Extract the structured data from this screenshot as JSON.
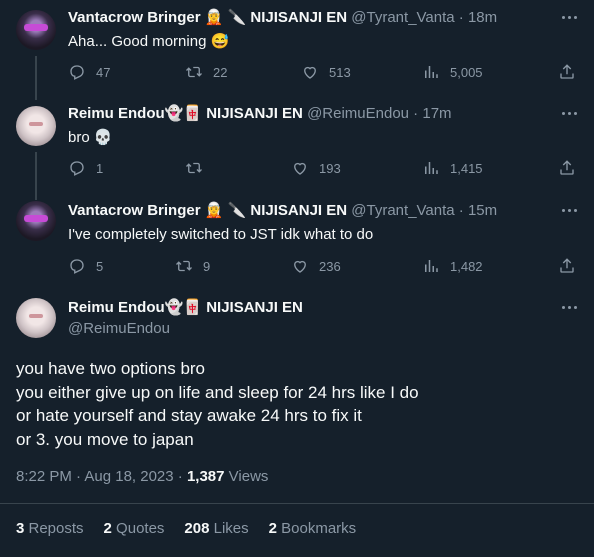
{
  "tweets": [
    {
      "name": "Vantacrow Bringer",
      "badges": "🧝 🔪 NIJISANJI EN",
      "handle": "@Tyrant_Vanta",
      "time": "18m",
      "text": "Aha... Good morning 😅",
      "replies": "47",
      "retweets": "22",
      "likes": "513",
      "views": "5,005"
    },
    {
      "name": "Reimu Endou",
      "badges": "👻🀄 NIJISANJI EN",
      "handle": "@ReimuEndou",
      "time": "17m",
      "text": "bro 💀",
      "replies": "1",
      "retweets": "",
      "likes": "193",
      "views": "1,415"
    },
    {
      "name": "Vantacrow Bringer",
      "badges": "🧝 🔪 NIJISANJI EN",
      "handle": "@Tyrant_Vanta",
      "time": "15m",
      "text": "I've completely switched to JST idk what to do",
      "replies": "5",
      "retweets": "9",
      "likes": "236",
      "views": "1,482"
    }
  ],
  "main_tweet": {
    "name": "Reimu Endou",
    "badges": "👻🀄 NIJISANJI EN",
    "handle": "@ReimuEndou",
    "lines": [
      "you have two options bro",
      "you either give up on life and sleep for 24 hrs like I do",
      "or hate yourself and stay awake 24 hrs to fix it",
      "or 3. you move to japan"
    ],
    "timestamp": "8:22 PM · Aug 18, 2023 · ",
    "views_count": "1,387",
    "views_label": " Views",
    "reposts_count": "3",
    "reposts_label": " Reposts",
    "quotes_count": "2",
    "quotes_label": " Quotes",
    "likes_count": "208",
    "likes_label": " Likes",
    "bookmarks_count": "2",
    "bookmarks_label": " Bookmarks"
  },
  "separator": " · ",
  "colors": {
    "background": "#15202b",
    "text": "#f7f9f9",
    "muted": "#8b98a5",
    "border": "#38444d"
  },
  "icons": [
    "reply-icon",
    "retweet-icon",
    "like-icon",
    "views-icon",
    "share-icon",
    "more-icon"
  ]
}
